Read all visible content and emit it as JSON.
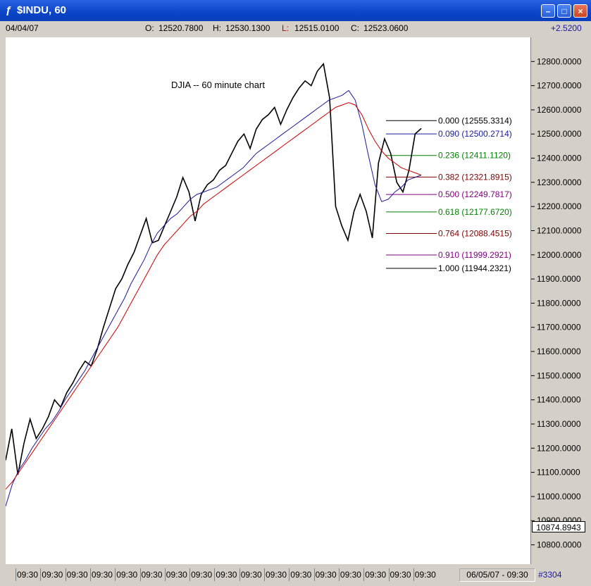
{
  "window": {
    "title": "$INDU, 60",
    "title_icon": "chart-icon",
    "buttons": [
      "minimize",
      "maximize",
      "close"
    ]
  },
  "infobar": {
    "date": "04/04/07",
    "open_label": "O:",
    "open_value": "12520.7800",
    "high_label": "H:",
    "high_value": "12530.1300",
    "low_label": "L:",
    "low_value": "12515.0100",
    "close_label": "C:",
    "close_value": "12523.0600",
    "change": "+2.5200"
  },
  "chart_data": {
    "type": "line",
    "title": "DJIA -- 60 minute chart",
    "series": [
      {
        "values": [
          11150,
          11280,
          11090,
          11220,
          11320,
          11240,
          11280,
          11330,
          11400,
          11370,
          11430,
          11470,
          11520,
          11560,
          11540,
          11610,
          11700,
          11780,
          11860,
          11900,
          11960,
          12010,
          12080,
          12150,
          12050,
          12060,
          12120,
          12180,
          12240,
          12320,
          12260,
          12140,
          12250,
          12290,
          12310,
          12350,
          12370,
          12420,
          12470,
          12500,
          12440,
          12520,
          12560,
          12580,
          12610,
          12540,
          12600,
          12650,
          12690,
          12720,
          12700,
          12760,
          12790,
          12650,
          12200,
          12120,
          12060,
          12180,
          12250,
          12180,
          12070,
          12380,
          12480,
          12420,
          12300,
          12260,
          12350,
          12500,
          12523
        ],
        "color": "#000000"
      },
      {
        "values": [
          10960,
          11050,
          11110,
          11150,
          11200,
          11240,
          11280,
          11310,
          11350,
          11400,
          11440,
          11480,
          11520,
          11570,
          11620,
          11670,
          11720,
          11770,
          11820,
          11880,
          11930,
          11980,
          12040,
          12090,
          12120,
          12150,
          12170,
          12200,
          12230,
          12250,
          12260,
          12270,
          12280,
          12300,
          12320,
          12340,
          12360,
          12390,
          12420,
          12440,
          12460,
          12480,
          12500,
          12520,
          12540,
          12560,
          12580,
          12600,
          12620,
          12640,
          12650,
          12660,
          12680,
          12640,
          12540,
          12410,
          12290,
          12220,
          12230,
          12260,
          12280,
          12310,
          12320,
          12330
        ],
        "color": "#1a1aa0"
      },
      {
        "values": [
          11030,
          11060,
          11100,
          11140,
          11180,
          11220,
          11260,
          11300,
          11340,
          11380,
          11420,
          11460,
          11500,
          11540,
          11580,
          11620,
          11660,
          11700,
          11750,
          11800,
          11850,
          11900,
          11950,
          12000,
          12040,
          12070,
          12100,
          12130,
          12160,
          12180,
          12210,
          12230,
          12250,
          12270,
          12290,
          12310,
          12330,
          12350,
          12370,
          12390,
          12410,
          12430,
          12450,
          12470,
          12490,
          12510,
          12530,
          12550,
          12570,
          12590,
          12610,
          12620,
          12630,
          12620,
          12580,
          12520,
          12470,
          12430,
          12400,
          12380,
          12360,
          12350,
          12340,
          12330
        ],
        "color": "#cc0000"
      }
    ],
    "y_ticks": [
      "12800.0000",
      "12700.0000",
      "12600.0000",
      "12500.0000",
      "12400.0000",
      "12300.0000",
      "12200.0000",
      "12100.0000",
      "12000.0000",
      "11900.0000",
      "11800.0000",
      "11700.0000",
      "11600.0000",
      "11500.0000",
      "11400.0000",
      "11300.0000",
      "11200.0000",
      "11100.0000",
      "11000.0000",
      "10900.0000",
      "10800.0000"
    ],
    "ylim": [
      10720,
      12900
    ],
    "x_tick_label": "09:30",
    "x_tick_count": 17,
    "current_price": "10874.8943",
    "fibonacci": [
      {
        "ratio": "0.000",
        "price": "12555.3314",
        "value": 12555.3314,
        "color": "#000000"
      },
      {
        "ratio": "0.090",
        "price": "12500.2714",
        "value": 12500.2714,
        "color": "#1a1aa0"
      },
      {
        "ratio": "0.236",
        "price": "12411.1120",
        "value": 12411.112,
        "color": "#008000"
      },
      {
        "ratio": "0.382",
        "price": "12321.8915",
        "value": 12321.8915,
        "color": "#800000"
      },
      {
        "ratio": "0.500",
        "price": "12249.7817",
        "value": 12249.7817,
        "color": "#800080"
      },
      {
        "ratio": "0.618",
        "price": "12177.6720",
        "value": 12177.672,
        "color": "#008000"
      },
      {
        "ratio": "0.764",
        "price": "12088.4515",
        "value": 12088.4515,
        "color": "#800000"
      },
      {
        "ratio": "0.910",
        "price": "11999.2921",
        "value": 11999.2921,
        "color": "#800080"
      },
      {
        "ratio": "1.000",
        "price": "11944.2321",
        "value": 11944.2321,
        "color": "#000000"
      }
    ]
  },
  "timebar": {
    "date_range": "06/05/07 - 09:30",
    "count": "#3304"
  }
}
